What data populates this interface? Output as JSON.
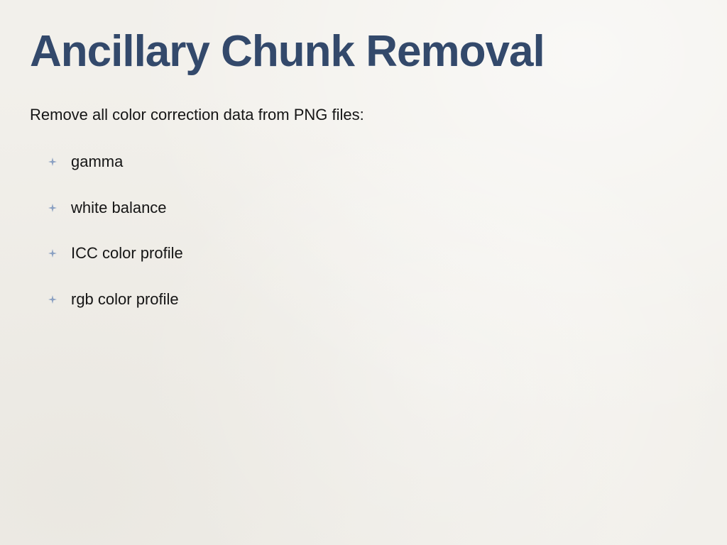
{
  "slide": {
    "title": "Ancillary Chunk Removal",
    "intro": "Remove all color correction data from PNG files:",
    "bullet_icon": "sparkle-bullet-icon",
    "accent_color": "#33496b",
    "bullet_color": "#8aa0c2",
    "bullets": [
      "gamma",
      "white balance",
      "ICC color profile",
      "rgb color profile"
    ]
  }
}
